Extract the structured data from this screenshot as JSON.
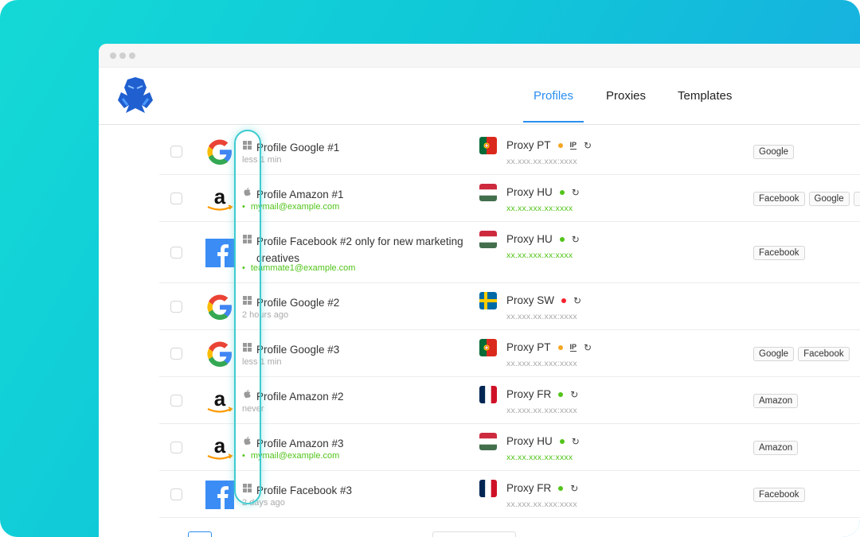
{
  "nav": {
    "tabs": [
      {
        "label": "Profiles",
        "active": true
      },
      {
        "label": "Proxies"
      },
      {
        "label": "Templates"
      }
    ]
  },
  "colors": {
    "accent": "#2a8ef0",
    "online": "#52c41a",
    "warning": "#f5a623",
    "offline": "#f5222d"
  },
  "rows": [
    {
      "brand": "google",
      "os": "windows",
      "name": "Profile Google #1",
      "sub": "less 1 min",
      "sub_green": false,
      "flag": "pt",
      "proxy": "Proxy PT",
      "status": "warning",
      "ip_icon": true,
      "ip": "xx.xxx.xx.xxx:xxxx",
      "ip_green": false,
      "tags": [
        "Google"
      ]
    },
    {
      "brand": "amazon",
      "os": "apple",
      "name": "Profile Amazon #1",
      "sub": "mymail@example.com",
      "sub_green": true,
      "flag": "hu",
      "proxy": "Proxy HU",
      "status": "online",
      "ip_icon": false,
      "ip": "xx.xx.xxx.xx:xxxx",
      "ip_green": true,
      "tags": [
        "Facebook",
        "Google",
        ""
      ]
    },
    {
      "brand": "facebook",
      "os": "windows",
      "name": "Profile Facebook #2 only for new marketing creatives",
      "sub": "teammate1@example.com",
      "sub_green": true,
      "flag": "hu",
      "proxy": "Proxy HU",
      "status": "online",
      "ip_icon": false,
      "ip": "xx.xx.xxx.xx:xxxx",
      "ip_green": true,
      "tags": [
        "Facebook"
      ]
    },
    {
      "brand": "google",
      "os": "windows",
      "name": "Profile Google #2",
      "sub": "2 hours ago",
      "sub_green": false,
      "flag": "se",
      "proxy": "Proxy SW",
      "status": "offline",
      "ip_icon": false,
      "ip": "xx.xxx.xx.xxx:xxxx",
      "ip_green": false,
      "tags": []
    },
    {
      "brand": "google",
      "os": "windows",
      "name": "Profile Google #3",
      "sub": "less 1 min",
      "sub_green": false,
      "flag": "pt",
      "proxy": "Proxy PT",
      "status": "warning",
      "ip_icon": true,
      "ip": "xx.xxx.xx.xxx:xxxx",
      "ip_green": false,
      "tags": [
        "Google",
        "Facebook"
      ]
    },
    {
      "brand": "amazon",
      "os": "apple",
      "name": "Profile Amazon #2",
      "sub": "never",
      "sub_green": false,
      "flag": "fr",
      "proxy": "Proxy FR",
      "status": "online",
      "ip_icon": false,
      "ip": "xx.xxx.xx.xxx:xxxx",
      "ip_green": false,
      "tags": [
        "Amazon"
      ]
    },
    {
      "brand": "amazon",
      "os": "apple",
      "name": "Profile Amazon #3",
      "sub": "mymail@example.com",
      "sub_green": true,
      "flag": "hu",
      "proxy": "Proxy HU",
      "status": "online",
      "ip_icon": false,
      "ip": "xx.xx.xxx.xx:xxxx",
      "ip_green": true,
      "tags": [
        "Amazon"
      ]
    },
    {
      "brand": "facebook",
      "os": "windows",
      "name": "Profile Facebook #3",
      "sub": "2 days ago",
      "sub_green": false,
      "flag": "fr",
      "proxy": "Proxy FR",
      "status": "online",
      "ip_icon": false,
      "ip": "xx.xxx.xx.xxx:xxxx",
      "ip_green": false,
      "tags": [
        "Facebook"
      ]
    }
  ]
}
